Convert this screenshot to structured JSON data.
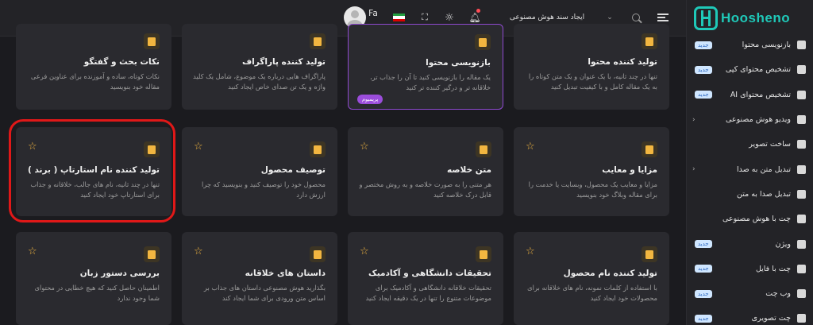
{
  "brand": {
    "name": "Hoosheno",
    "color": "#1fc8b8"
  },
  "topbar": {
    "title": "ایجاد سند هوش مصنوعی",
    "language": "Fa",
    "icons": [
      "menu-icon",
      "search-icon",
      "chevron-down-icon",
      "bell-icon",
      "sun-icon",
      "fullscreen-icon",
      "iran-flag-icon",
      "avatar"
    ]
  },
  "sidebar": {
    "items": [
      {
        "label": "بازنویسی محتوا",
        "badge": "جدید",
        "icon": "pen-icon"
      },
      {
        "label": "تشخیص محتوای کپی",
        "badge": "جدید",
        "icon": "shield-icon"
      },
      {
        "label": "تشخیص محتوای AI",
        "badge": "جدید",
        "icon": "document-icon"
      },
      {
        "label": "ویدیو هوش مصنوعی",
        "badge": "",
        "icon": "video-icon",
        "chevron": "›"
      },
      {
        "label": "ساخت تصویر",
        "badge": "",
        "icon": "image-icon"
      },
      {
        "label": "تبدیل متن به صدا",
        "badge": "",
        "icon": "waveform-icon",
        "chevron": "›"
      },
      {
        "label": "تبدیل صدا به متن",
        "badge": "",
        "icon": "audio-file-icon"
      },
      {
        "label": "چت با هوش مصنوعی",
        "badge": "",
        "icon": "chat-icon"
      },
      {
        "label": "ویژن",
        "badge": "جدید",
        "icon": "eye-icon"
      },
      {
        "label": "چت با فایل",
        "badge": "جدید",
        "icon": "file-chat-icon"
      },
      {
        "label": "وب چت",
        "badge": "جدید",
        "icon": "globe-icon"
      },
      {
        "label": "چت تصویری",
        "badge": "جدید",
        "icon": "image-chat-icon"
      }
    ]
  },
  "cards": [
    {
      "title": "نکات بحث و گفتگو",
      "desc": "نکات کوتاه، ساده و آموزنده برای عناوین فرعی مقاله خود بنویسید",
      "row": 0,
      "col": 0
    },
    {
      "title": "تولید کننده پاراگراف",
      "desc": "پاراگراف هایی درباره یک موضوع، شامل یک کلید واژه و یک تن صدای خاص ایجاد کنید",
      "row": 0,
      "col": 1
    },
    {
      "title": "بازنویسی محتوا",
      "desc": "یک مقاله را بازنویسی کنید تا آن را جذاب تر، خلاقانه تر و درگیر کننده تر کنید",
      "row": 0,
      "col": 2,
      "premium": "پریمیوم"
    },
    {
      "title": "تولید کننده محتوا",
      "desc": "تنها در چند ثانیه، با یک عنوان و یک متن کوتاه را به یک مقاله کامل و با کیفیت تبدیل کنید",
      "row": 0,
      "col": 3
    },
    {
      "title": "تولید کننده نام استارتاپ ( برند )",
      "desc": "تنها در چند ثانیه، نام های جالب، خلاقانه و جذاب برای استارتاپ خود ایجاد کنید",
      "row": 1,
      "col": 0
    },
    {
      "title": "توصیف محصول",
      "desc": "محصول خود را توصیف کنید و بنویسید که چرا ارزش دارد",
      "row": 1,
      "col": 1
    },
    {
      "title": "متن خلاصه",
      "desc": "هر متنی را به صورت خلاصه و به روش مختصر و قابل درک خلاصه کنید",
      "row": 1,
      "col": 2
    },
    {
      "title": "مزایا و معایب",
      "desc": "مزایا و معایب یک محصول، وبسایت یا خدمت را برای مقاله وبلاگ خود بنویسید",
      "row": 1,
      "col": 3
    },
    {
      "title": "بررسی دستور زبان",
      "desc": "اطمینان حاصل کنید که هیچ خطایی در محتوای شما وجود ندارد",
      "row": 2,
      "col": 0
    },
    {
      "title": "داستان های خلاقانه",
      "desc": "بگذارید هوش مصنوعی داستان های جذاب بر اساس متن ورودی برای شما ایجاد کند",
      "row": 2,
      "col": 1
    },
    {
      "title": "تحقیقات دانشگاهی و آکادمیک",
      "desc": "تحقیقات خلاقانه دانشگاهی و آکادمیک برای موضوعات متنوع را تنها در یک دقیقه ایجاد کنید",
      "row": 2,
      "col": 2
    },
    {
      "title": "تولید کننده نام محصول",
      "desc": "با استفاده از کلمات نمونه، نام های خلاقانه برای محصولات خود ایجاد کنید",
      "row": 2,
      "col": 3
    }
  ],
  "colors": {
    "accent": "#f2b640",
    "premium": "#9b4ddb",
    "highlight": "#e01818"
  }
}
